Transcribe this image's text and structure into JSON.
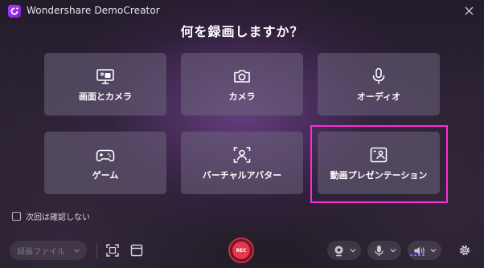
{
  "window": {
    "title": "Wondershare DemoCreator"
  },
  "heading": "何を録画しますか？",
  "options": [
    {
      "label": "画面とカメラ",
      "icon": "screen-camera-icon"
    },
    {
      "label": "カメラ",
      "icon": "camera-icon"
    },
    {
      "label": "オーディオ",
      "icon": "microphone-icon"
    },
    {
      "label": "ゲーム",
      "icon": "gamepad-icon"
    },
    {
      "label": "バーチャルアバター",
      "icon": "avatar-icon"
    },
    {
      "label": "動画プレゼンテーション",
      "icon": "presentation-icon"
    }
  ],
  "highlighted_option": "動画プレゼンテーション",
  "skip_checkbox": {
    "label": "次回は確認しない",
    "checked": false
  },
  "toolbar": {
    "save_target": "録画ファイル",
    "rec_label": "REC",
    "icons": [
      "capture-area-icon",
      "window-icon",
      "webcam-icon",
      "microphone-icon",
      "speaker-icon",
      "gear-icon"
    ]
  },
  "colors": {
    "accent_purple": "#b23cff",
    "highlight_border": "#ff2bd6",
    "rec_red": "#e03a4c",
    "card_bg": "#6e647d"
  }
}
